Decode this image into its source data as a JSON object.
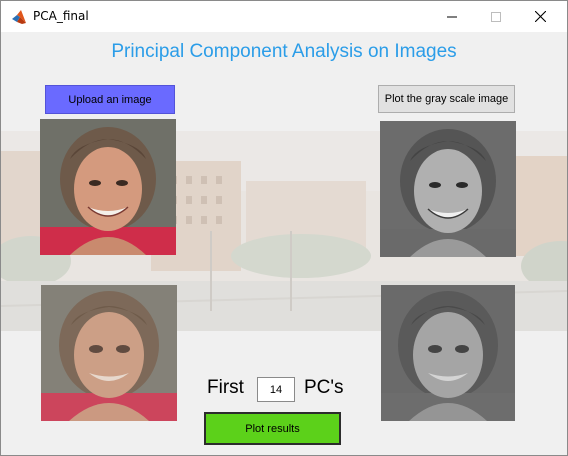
{
  "window": {
    "title": "PCA_final",
    "controls": [
      "minimize-icon",
      "maximize-icon",
      "close-icon"
    ]
  },
  "app": {
    "heading": "Principal Component Analysis on Images",
    "heading_color": "#2b9de8"
  },
  "buttons": {
    "upload_label": "Upload an image",
    "upload_color": "#6a6aff",
    "grayscale_label": "Plot the gray scale image",
    "plot_label": "Plot results",
    "plot_color": "#5cd11a"
  },
  "pc_controls": {
    "prefix": "First",
    "value": "14",
    "suffix": "PC's"
  }
}
